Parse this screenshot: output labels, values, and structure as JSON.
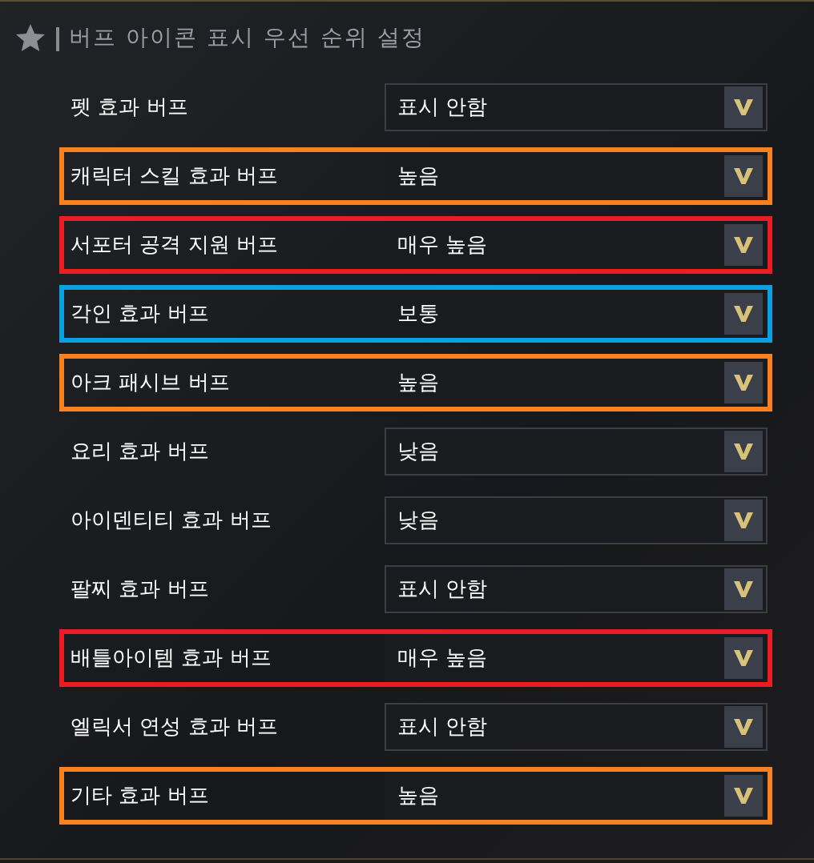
{
  "title": "버프 아이콘 표시 우선 순위 설정",
  "rows": [
    {
      "label": "펫 효과 버프",
      "value": "표시 안함"
    },
    {
      "label": "캐릭터 스킬 효과 버프",
      "value": "높음",
      "color": "#f7821f"
    },
    {
      "label": "서포터 공격 지원 버프",
      "value": "매우 높음",
      "color": "#ec1c24"
    },
    {
      "label": "각인 효과 버프",
      "value": "보통",
      "color": "#0aa0e2"
    },
    {
      "label": "아크 패시브 버프",
      "value": "높음",
      "color": "#f7821f"
    },
    {
      "label": "요리 효과 버프",
      "value": "낮음"
    },
    {
      "label": "아이덴티티 효과 버프",
      "value": "낮음"
    },
    {
      "label": "팔찌 효과 버프",
      "value": "표시 안함"
    },
    {
      "label": "배틀아이템 효과 버프",
      "value": "매우 높음",
      "color": "#ec1c24"
    },
    {
      "label": "엘릭서 연성 효과 버프",
      "value": "표시 안함"
    },
    {
      "label": "기타 효과 버프",
      "value": "높음",
      "color": "#f7821f"
    }
  ]
}
